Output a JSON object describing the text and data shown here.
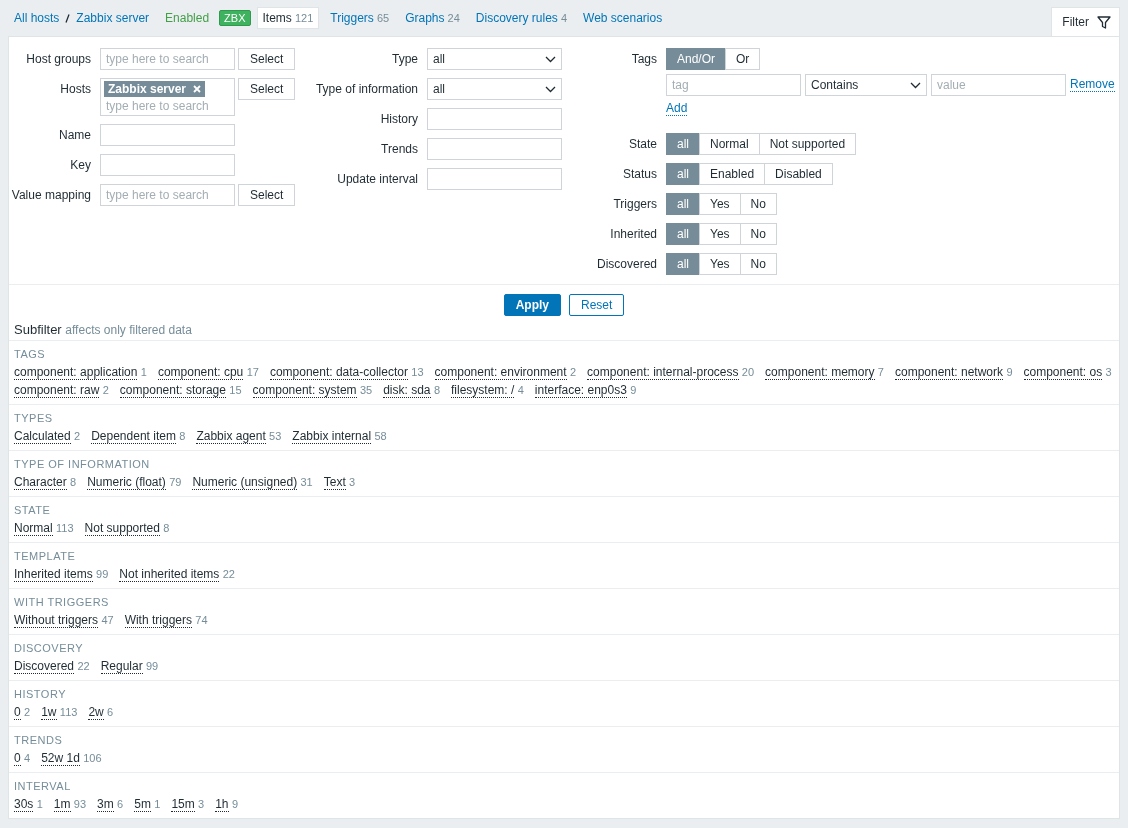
{
  "nav": {
    "breadcrumbs": [
      "All hosts",
      "Zabbix server"
    ],
    "status": "Enabled",
    "badge": "ZBX",
    "tabs": [
      {
        "label": "Items",
        "count": "121",
        "selected": true
      },
      {
        "label": "Triggers",
        "count": "65",
        "selected": false
      },
      {
        "label": "Graphs",
        "count": "24",
        "selected": false
      },
      {
        "label": "Discovery rules",
        "count": "4",
        "selected": false
      },
      {
        "label": "Web scenarios",
        "selected": false
      }
    ]
  },
  "filter_tab": {
    "label": "Filter",
    "selected": true
  },
  "filter": {
    "columns": [
      {
        "fields": [
          {
            "label": "Host groups",
            "kind": "picker",
            "placeholder": "type here to search",
            "button": "Select"
          },
          {
            "label": "Hosts",
            "kind": "picker",
            "chips": [
              "Zabbix server"
            ],
            "placeholder": "type here to search",
            "button": "Select"
          },
          {
            "label": "Name",
            "kind": "text"
          },
          {
            "label": "Key",
            "kind": "text"
          },
          {
            "label": "Value mapping",
            "kind": "picker",
            "placeholder": "type here to search",
            "button": "Select"
          }
        ]
      },
      {
        "fields": [
          {
            "label": "Type",
            "kind": "select",
            "value": "all"
          },
          {
            "label": "Type of information",
            "kind": "select",
            "value": "all"
          },
          {
            "label": "History",
            "kind": "text"
          },
          {
            "label": "Trends",
            "kind": "text"
          },
          {
            "label": "Update interval",
            "kind": "text"
          }
        ]
      },
      {
        "fields": [
          {
            "label": "Tags",
            "kind": "tags",
            "options": [
              {
                "label": "And/Or",
                "selected": true
              },
              {
                "label": "Or",
                "selected": false
              }
            ],
            "rows": [
              {
                "tag_placeholder": "tag",
                "operator": "Contains",
                "value_placeholder": "value",
                "action": "Remove"
              }
            ],
            "add": "Add"
          },
          {
            "label": "State",
            "kind": "segmented",
            "options": [
              {
                "label": "all",
                "selected": true
              },
              {
                "label": "Normal",
                "selected": false
              },
              {
                "label": "Not supported",
                "selected": false
              }
            ]
          },
          {
            "label": "Status",
            "kind": "segmented",
            "options": [
              {
                "label": "all",
                "selected": true
              },
              {
                "label": "Enabled",
                "selected": false
              },
              {
                "label": "Disabled",
                "selected": false
              }
            ]
          },
          {
            "label": "Triggers",
            "kind": "segmented",
            "options": [
              {
                "label": "all",
                "selected": true
              },
              {
                "label": "Yes",
                "selected": false
              },
              {
                "label": "No",
                "selected": false
              }
            ]
          },
          {
            "label": "Inherited",
            "kind": "segmented",
            "options": [
              {
                "label": "all",
                "selected": true
              },
              {
                "label": "Yes",
                "selected": false
              },
              {
                "label": "No",
                "selected": false
              }
            ]
          },
          {
            "label": "Discovered",
            "kind": "segmented",
            "options": [
              {
                "label": "all",
                "selected": true
              },
              {
                "label": "Yes",
                "selected": false
              },
              {
                "label": "No",
                "selected": false
              }
            ]
          }
        ]
      }
    ],
    "buttons": [
      {
        "label": "Apply",
        "kind": "primary"
      },
      {
        "label": "Reset",
        "kind": "secondary"
      }
    ]
  },
  "subfilter": {
    "title": "Subfilter",
    "note": "affects only filtered data",
    "groups": [
      {
        "heading": "TAGS",
        "items": [
          {
            "label": "component: application",
            "count": "1"
          },
          {
            "label": "component: cpu",
            "count": "17"
          },
          {
            "label": "component: data-collector",
            "count": "13"
          },
          {
            "label": "component: environment",
            "count": "2"
          },
          {
            "label": "component: internal-process",
            "count": "20"
          },
          {
            "label": "component: memory",
            "count": "7"
          },
          {
            "label": "component: network",
            "count": "9"
          },
          {
            "label": "component: os",
            "count": "3"
          },
          {
            "label": "component: raw",
            "count": "2"
          },
          {
            "label": "component: storage",
            "count": "15"
          },
          {
            "label": "component: system",
            "count": "35"
          },
          {
            "label": "disk: sda",
            "count": "8"
          },
          {
            "label": "filesystem: /",
            "count": "4"
          },
          {
            "label": "interface: enp0s3",
            "count": "9"
          }
        ]
      },
      {
        "heading": "TYPES",
        "items": [
          {
            "label": "Calculated",
            "count": "2"
          },
          {
            "label": "Dependent item",
            "count": "8"
          },
          {
            "label": "Zabbix agent",
            "count": "53"
          },
          {
            "label": "Zabbix internal",
            "count": "58"
          }
        ]
      },
      {
        "heading": "TYPE OF INFORMATION",
        "items": [
          {
            "label": "Character",
            "count": "8"
          },
          {
            "label": "Numeric (float)",
            "count": "79"
          },
          {
            "label": "Numeric (unsigned)",
            "count": "31"
          },
          {
            "label": "Text",
            "count": "3"
          }
        ]
      },
      {
        "heading": "STATE",
        "items": [
          {
            "label": "Normal",
            "count": "113"
          },
          {
            "label": "Not supported",
            "count": "8"
          }
        ]
      },
      {
        "heading": "TEMPLATE",
        "items": [
          {
            "label": "Inherited items",
            "count": "99"
          },
          {
            "label": "Not inherited items",
            "count": "22"
          }
        ]
      },
      {
        "heading": "WITH TRIGGERS",
        "items": [
          {
            "label": "Without triggers",
            "count": "47"
          },
          {
            "label": "With triggers",
            "count": "74"
          }
        ]
      },
      {
        "heading": "DISCOVERY",
        "items": [
          {
            "label": "Discovered",
            "count": "22"
          },
          {
            "label": "Regular",
            "count": "99"
          }
        ]
      },
      {
        "heading": "HISTORY",
        "items": [
          {
            "label": "0",
            "count": "2"
          },
          {
            "label": "1w",
            "count": "113"
          },
          {
            "label": "2w",
            "count": "6"
          }
        ]
      },
      {
        "heading": "TRENDS",
        "items": [
          {
            "label": "0",
            "count": "4"
          },
          {
            "label": "52w 1d",
            "count": "106"
          }
        ]
      },
      {
        "heading": "INTERVAL",
        "items": [
          {
            "label": "30s",
            "count": "1"
          },
          {
            "label": "1m",
            "count": "93"
          },
          {
            "label": "3m",
            "count": "6"
          },
          {
            "label": "5m",
            "count": "1"
          },
          {
            "label": "15m",
            "count": "3"
          },
          {
            "label": "1h",
            "count": "9"
          }
        ]
      }
    ]
  }
}
